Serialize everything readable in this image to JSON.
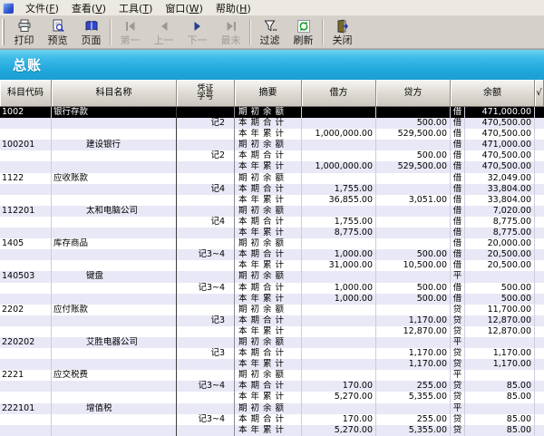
{
  "menu": {
    "items": [
      {
        "label": "文件(F)"
      },
      {
        "label": "查看(V)"
      },
      {
        "label": "工具(T)"
      },
      {
        "label": "窗口(W)"
      },
      {
        "label": "帮助(H)"
      }
    ]
  },
  "toolbar": {
    "buttons": [
      {
        "label": "打印",
        "icon": "print-icon",
        "enabled": true,
        "sep_after": false
      },
      {
        "label": "预览",
        "icon": "preview-icon",
        "enabled": true,
        "sep_after": false
      },
      {
        "label": "页面",
        "icon": "pages-icon",
        "enabled": true,
        "sep_after": true
      },
      {
        "label": "第一",
        "icon": "first-icon",
        "enabled": false,
        "sep_after": false
      },
      {
        "label": "上一",
        "icon": "prev-icon",
        "enabled": false,
        "sep_after": false
      },
      {
        "label": "下一",
        "icon": "next-icon",
        "enabled": false,
        "sep_after": false
      },
      {
        "label": "最末",
        "icon": "last-icon",
        "enabled": false,
        "sep_after": true
      },
      {
        "label": "过滤",
        "icon": "filter-icon",
        "enabled": true,
        "sep_after": false
      },
      {
        "label": "刷新",
        "icon": "refresh-icon",
        "enabled": true,
        "sep_after": true
      },
      {
        "label": "关闭",
        "icon": "close-icon",
        "enabled": true,
        "sep_after": false
      }
    ]
  },
  "title": "总账",
  "table": {
    "headers": {
      "code": "科目代码",
      "name": "科目名称",
      "voucher_line1": "凭证",
      "voucher_line2": "字号",
      "summary": "摘要",
      "debit": "借方",
      "credit": "贷方",
      "balance": "余额",
      "check": "√"
    },
    "summary_labels": {
      "opening": "期初余额",
      "period": "本期合计",
      "year": "本年累计"
    },
    "rows": [
      {
        "code": "1002",
        "name": "银行存款",
        "indent": false,
        "voucher": "",
        "summary": "期初余额",
        "debit": "",
        "credit": "",
        "direction": "借",
        "balance": "471,000.00",
        "selected": true
      },
      {
        "code": "",
        "name": "",
        "indent": false,
        "voucher": "记2",
        "summary": "本期合计",
        "debit": "",
        "credit": "500.00",
        "direction": "借",
        "balance": "470,500.00",
        "selected": false
      },
      {
        "code": "",
        "name": "",
        "indent": false,
        "voucher": "",
        "summary": "本年累计",
        "debit": "1,000,000.00",
        "credit": "529,500.00",
        "direction": "借",
        "balance": "470,500.00",
        "selected": false
      },
      {
        "code": "100201",
        "name": "建设银行",
        "indent": true,
        "voucher": "",
        "summary": "期初余额",
        "debit": "",
        "credit": "",
        "direction": "借",
        "balance": "471,000.00",
        "selected": false
      },
      {
        "code": "",
        "name": "",
        "indent": false,
        "voucher": "记2",
        "summary": "本期合计",
        "debit": "",
        "credit": "500.00",
        "direction": "借",
        "balance": "470,500.00",
        "selected": false
      },
      {
        "code": "",
        "name": "",
        "indent": false,
        "voucher": "",
        "summary": "本年累计",
        "debit": "1,000,000.00",
        "credit": "529,500.00",
        "direction": "借",
        "balance": "470,500.00",
        "selected": false
      },
      {
        "code": "1122",
        "name": "应收账款",
        "indent": false,
        "voucher": "",
        "summary": "期初余额",
        "debit": "",
        "credit": "",
        "direction": "借",
        "balance": "32,049.00",
        "selected": false
      },
      {
        "code": "",
        "name": "",
        "indent": false,
        "voucher": "记4",
        "summary": "本期合计",
        "debit": "1,755.00",
        "credit": "",
        "direction": "借",
        "balance": "33,804.00",
        "selected": false
      },
      {
        "code": "",
        "name": "",
        "indent": false,
        "voucher": "",
        "summary": "本年累计",
        "debit": "36,855.00",
        "credit": "3,051.00",
        "direction": "借",
        "balance": "33,804.00",
        "selected": false
      },
      {
        "code": "112201",
        "name": "太和电脑公司",
        "indent": true,
        "voucher": "",
        "summary": "期初余额",
        "debit": "",
        "credit": "",
        "direction": "借",
        "balance": "7,020.00",
        "selected": false
      },
      {
        "code": "",
        "name": "",
        "indent": false,
        "voucher": "记4",
        "summary": "本期合计",
        "debit": "1,755.00",
        "credit": "",
        "direction": "借",
        "balance": "8,775.00",
        "selected": false
      },
      {
        "code": "",
        "name": "",
        "indent": false,
        "voucher": "",
        "summary": "本年累计",
        "debit": "8,775.00",
        "credit": "",
        "direction": "借",
        "balance": "8,775.00",
        "selected": false
      },
      {
        "code": "1405",
        "name": "库存商品",
        "indent": false,
        "voucher": "",
        "summary": "期初余额",
        "debit": "",
        "credit": "",
        "direction": "借",
        "balance": "20,000.00",
        "selected": false
      },
      {
        "code": "",
        "name": "",
        "indent": false,
        "voucher": "记3~4",
        "summary": "本期合计",
        "debit": "1,000.00",
        "credit": "500.00",
        "direction": "借",
        "balance": "20,500.00",
        "selected": false
      },
      {
        "code": "",
        "name": "",
        "indent": false,
        "voucher": "",
        "summary": "本年累计",
        "debit": "31,000.00",
        "credit": "10,500.00",
        "direction": "借",
        "balance": "20,500.00",
        "selected": false
      },
      {
        "code": "140503",
        "name": "键盘",
        "indent": true,
        "voucher": "",
        "summary": "期初余额",
        "debit": "",
        "credit": "",
        "direction": "平",
        "balance": "",
        "selected": false
      },
      {
        "code": "",
        "name": "",
        "indent": false,
        "voucher": "记3~4",
        "summary": "本期合计",
        "debit": "1,000.00",
        "credit": "500.00",
        "direction": "借",
        "balance": "500.00",
        "selected": false
      },
      {
        "code": "",
        "name": "",
        "indent": false,
        "voucher": "",
        "summary": "本年累计",
        "debit": "1,000.00",
        "credit": "500.00",
        "direction": "借",
        "balance": "500.00",
        "selected": false
      },
      {
        "code": "2202",
        "name": "应付账款",
        "indent": false,
        "voucher": "",
        "summary": "期初余额",
        "debit": "",
        "credit": "",
        "direction": "贷",
        "balance": "11,700.00",
        "selected": false
      },
      {
        "code": "",
        "name": "",
        "indent": false,
        "voucher": "记3",
        "summary": "本期合计",
        "debit": "",
        "credit": "1,170.00",
        "direction": "贷",
        "balance": "12,870.00",
        "selected": false
      },
      {
        "code": "",
        "name": "",
        "indent": false,
        "voucher": "",
        "summary": "本年累计",
        "debit": "",
        "credit": "12,870.00",
        "direction": "贷",
        "balance": "12,870.00",
        "selected": false
      },
      {
        "code": "220202",
        "name": "艾胜电器公司",
        "indent": true,
        "voucher": "",
        "summary": "期初余额",
        "debit": "",
        "credit": "",
        "direction": "平",
        "balance": "",
        "selected": false
      },
      {
        "code": "",
        "name": "",
        "indent": false,
        "voucher": "记3",
        "summary": "本期合计",
        "debit": "",
        "credit": "1,170.00",
        "direction": "贷",
        "balance": "1,170.00",
        "selected": false
      },
      {
        "code": "",
        "name": "",
        "indent": false,
        "voucher": "",
        "summary": "本年累计",
        "debit": "",
        "credit": "1,170.00",
        "direction": "贷",
        "balance": "1,170.00",
        "selected": false
      },
      {
        "code": "2221",
        "name": "应交税费",
        "indent": false,
        "voucher": "",
        "summary": "期初余额",
        "debit": "",
        "credit": "",
        "direction": "平",
        "balance": "",
        "selected": false
      },
      {
        "code": "",
        "name": "",
        "indent": false,
        "voucher": "记3~4",
        "summary": "本期合计",
        "debit": "170.00",
        "credit": "255.00",
        "direction": "贷",
        "balance": "85.00",
        "selected": false
      },
      {
        "code": "",
        "name": "",
        "indent": false,
        "voucher": "",
        "summary": "本年累计",
        "debit": "5,270.00",
        "credit": "5,355.00",
        "direction": "贷",
        "balance": "85.00",
        "selected": false
      },
      {
        "code": "222101",
        "name": "增值税",
        "indent": true,
        "voucher": "",
        "summary": "期初余额",
        "debit": "",
        "credit": "",
        "direction": "平",
        "balance": "",
        "selected": false
      },
      {
        "code": "",
        "name": "",
        "indent": false,
        "voucher": "记3~4",
        "summary": "本期合计",
        "debit": "170.00",
        "credit": "255.00",
        "direction": "贷",
        "balance": "85.00",
        "selected": false
      },
      {
        "code": "",
        "name": "",
        "indent": false,
        "voucher": "",
        "summary": "本年累计",
        "debit": "5,270.00",
        "credit": "5,355.00",
        "direction": "贷",
        "balance": "85.00",
        "selected": false
      }
    ]
  },
  "colors": {
    "accent_band_top": "#6ed2f2",
    "accent_band_bottom": "#1d9fd4",
    "selected_row_bg": "#000000",
    "selected_row_text": "#ffffff",
    "row_alt_bg": "#e8e8f6",
    "toolbar_bg": "#d5d1ca",
    "refresh_green": "#0a9a1a"
  }
}
